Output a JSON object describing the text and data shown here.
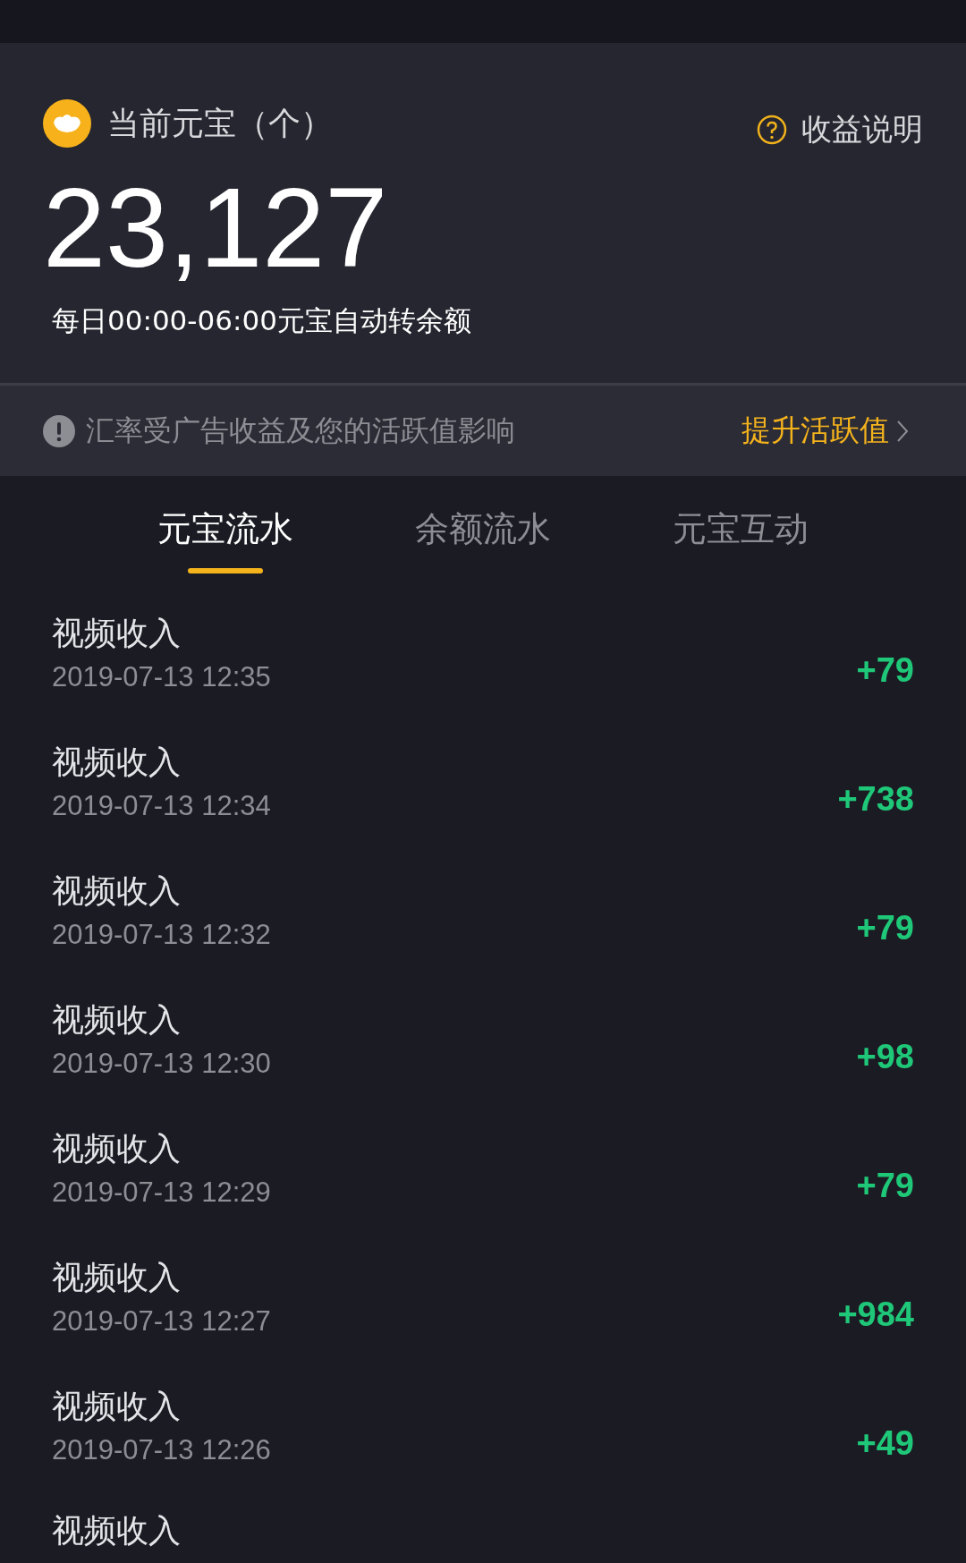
{
  "header": {
    "title": "当前元宝（个）",
    "help_link": "收益说明",
    "balance": "23,127",
    "note": "每日00:00-06:00元宝自动转余额"
  },
  "notice": {
    "text": "汇率受广告收益及您的活跃值影响",
    "action": "提升活跃值"
  },
  "tabs": [
    {
      "label": "元宝流水",
      "selected": true
    },
    {
      "label": "余额流水",
      "selected": false
    },
    {
      "label": "元宝互动",
      "selected": false
    }
  ],
  "records": [
    {
      "title": "视频收入",
      "time": "2019-07-13 12:35",
      "amount": "+79"
    },
    {
      "title": "视频收入",
      "time": "2019-07-13 12:34",
      "amount": "+738"
    },
    {
      "title": "视频收入",
      "time": "2019-07-13 12:32",
      "amount": "+79"
    },
    {
      "title": "视频收入",
      "time": "2019-07-13 12:30",
      "amount": "+98"
    },
    {
      "title": "视频收入",
      "time": "2019-07-13 12:29",
      "amount": "+79"
    },
    {
      "title": "视频收入",
      "time": "2019-07-13 12:27",
      "amount": "+984"
    },
    {
      "title": "视频收入",
      "time": "2019-07-13 12:26",
      "amount": "+49"
    },
    {
      "title": "视频收入"
    }
  ]
}
